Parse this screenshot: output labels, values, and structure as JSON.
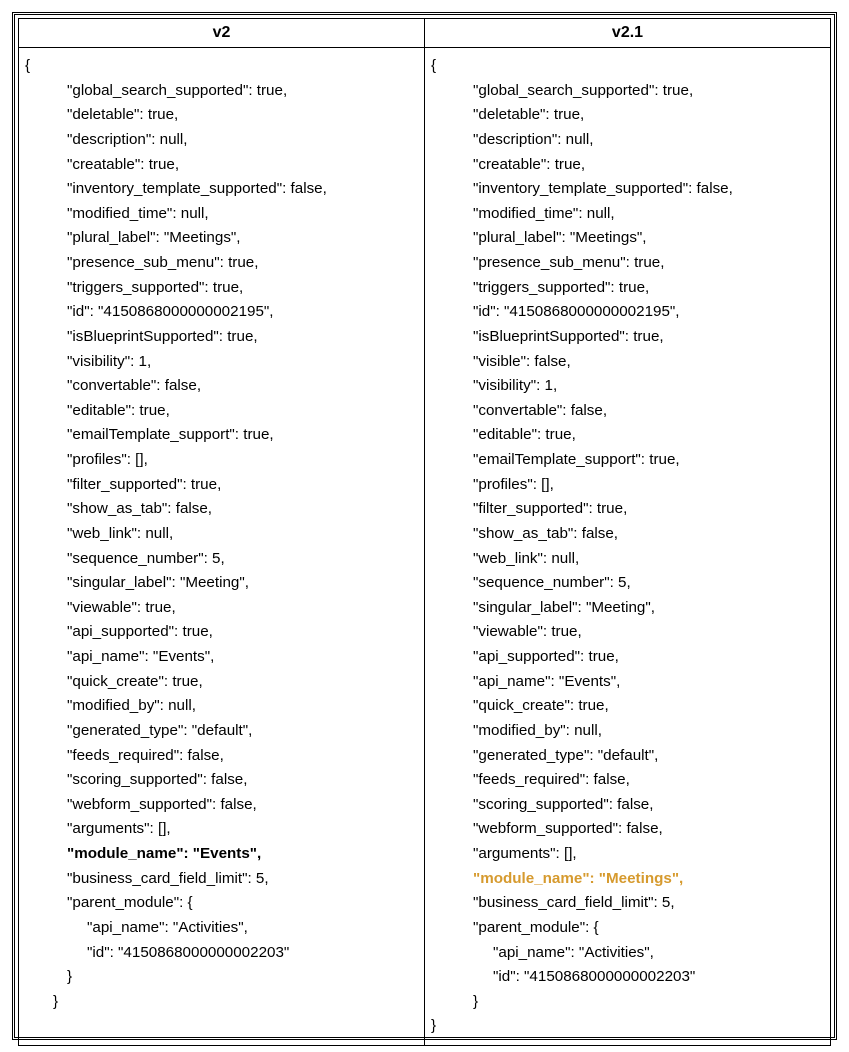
{
  "headers": {
    "col1": "v2",
    "col2": "v2.1"
  },
  "v2": {
    "open": "{",
    "lines": [
      "\"global_search_supported\": true,",
      "\"deletable\": true,",
      "\"description\": null,",
      "\"creatable\": true,",
      "\"inventory_template_supported\": false,",
      "\"modified_time\": null,",
      "\"plural_label\": \"Meetings\",",
      "\"presence_sub_menu\": true,",
      "\"triggers_supported\": true,",
      "\"id\": \"4150868000000002195\",",
      "\"isBlueprintSupported\": true,",
      "\"visibility\": 1,",
      "\"convertable\": false,",
      "\"editable\": true,",
      "\"emailTemplate_support\": true,",
      "\"profiles\": [],",
      "\"filter_supported\": true,",
      "\"show_as_tab\": false,",
      "\"web_link\": null,",
      "\"sequence_number\": 5,",
      "\"singular_label\": \"Meeting\",",
      "\"viewable\": true,",
      "\"api_supported\": true,",
      "\"api_name\": \"Events\",",
      "\"quick_create\": true,",
      "\"modified_by\": null,",
      "\"generated_type\": \"default\",",
      "\"feeds_required\": false,",
      "\"scoring_supported\": false,",
      "\"webform_supported\": false,",
      "\"arguments\": [],"
    ],
    "module_line": "\"module_name\": \"Events\",",
    "after": [
      "\"business_card_field_limit\": 5,",
      "\"parent_module\": {"
    ],
    "nested": [
      "\"api_name\": \"Activities\",",
      "\"id\": \"4150868000000002203\""
    ],
    "close_inner": "}",
    "close_outer": "}"
  },
  "v21": {
    "open": "{",
    "lines": [
      "\"global_search_supported\": true,",
      "\"deletable\": true,",
      "\"description\": null,",
      "\"creatable\": true,",
      "\"inventory_template_supported\": false,",
      "\"modified_time\": null,",
      "\"plural_label\": \"Meetings\",",
      "\"presence_sub_menu\": true,",
      "\"triggers_supported\": true,",
      "\"id\": \"4150868000000002195\",",
      "\"isBlueprintSupported\": true,",
      "\"visible\": false,",
      "\"visibility\": 1,",
      "\"convertable\": false,",
      "\"editable\": true,",
      "\"emailTemplate_support\": true,",
      "\"profiles\": [],",
      "\"filter_supported\": true,",
      "\"show_as_tab\": false,",
      "\"web_link\": null,",
      "\"sequence_number\": 5,",
      "\"singular_label\": \"Meeting\",",
      "\"viewable\": true,",
      "\"api_supported\": true,",
      "\"api_name\": \"Events\",",
      "\"quick_create\": true,",
      "\"modified_by\": null,",
      "\"generated_type\": \"default\",",
      "\"feeds_required\": false,",
      "\"scoring_supported\": false,",
      "\"webform_supported\": false,",
      "\"arguments\": [],"
    ],
    "module_line": "\"module_name\": \"Meetings\",",
    "after": [
      "\"business_card_field_limit\": 5,",
      "\"parent_module\": {"
    ],
    "nested": [
      "\"api_name\": \"Activities\",",
      "\"id\": \"4150868000000002203\""
    ],
    "close_inner": "}",
    "close_outer": "}"
  }
}
